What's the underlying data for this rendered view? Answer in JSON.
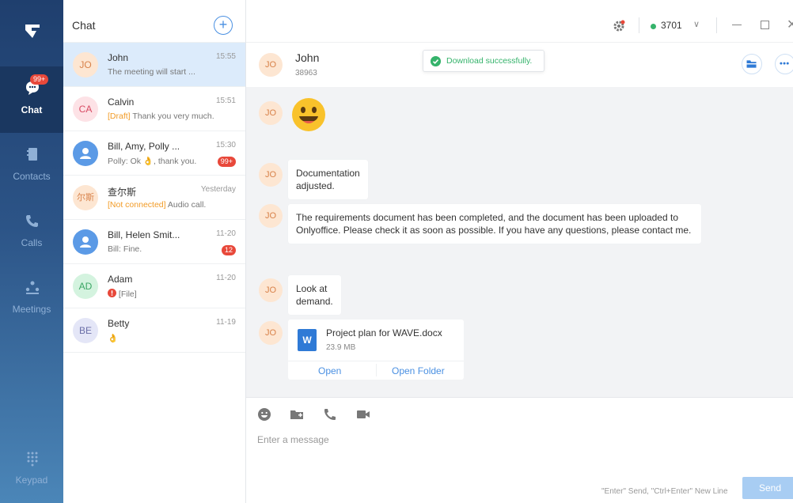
{
  "rail": {
    "chat_label": "Chat",
    "chat_badge": "99+",
    "contacts_label": "Contacts",
    "calls_label": "Calls",
    "meetings_label": "Meetings",
    "keypad_label": "Keypad"
  },
  "list": {
    "title": "Chat",
    "add": "+",
    "conversations": [
      {
        "initials": "JO",
        "name": "John",
        "time": "15:55",
        "tag": "",
        "preview": "The meeting will start ...",
        "count": ""
      },
      {
        "initials": "CA",
        "name": "Calvin",
        "time": "15:51",
        "tag": "[Draft]",
        "preview": " Thank you very much.",
        "count": ""
      },
      {
        "initials": "",
        "name": "Bill, Amy, Polly ...",
        "time": "15:30",
        "tag": "",
        "preview": "Polly: Ok 👌, thank you.",
        "count": "99+"
      },
      {
        "initials": "尔斯",
        "name": "查尔斯",
        "time": "Yesterday",
        "tag": "[Not connected]",
        "preview": " Audio call.",
        "count": ""
      },
      {
        "initials": "",
        "name": "Bill, Helen Smit...",
        "time": "11-20",
        "tag": "",
        "preview": "Bill: Fine.",
        "count": "12"
      },
      {
        "initials": "AD",
        "name": "Adam",
        "time": "11-20",
        "tag": "",
        "preview": "[File]",
        "count": ""
      },
      {
        "initials": "BE",
        "name": "Betty",
        "time": "11-19",
        "tag": "",
        "preview": "👌",
        "count": ""
      }
    ]
  },
  "topbar": {
    "extension": "3701",
    "caret": "∨",
    "close": "✕"
  },
  "chat": {
    "contact_initials": "JO",
    "contact_name": "John",
    "contact_number": "38963",
    "toast": "Download successfully.",
    "messages": [
      {
        "text": "Documentation adjusted."
      },
      {
        "text": "The requirements document has been completed, and the document has been uploaded to Onlyoffice. Please check it as soon as possible. If you have any questions, please contact me."
      },
      {
        "text": "Look at demand."
      }
    ],
    "file": {
      "icon_letter": "W",
      "name": "Project plan for WAVE.docx",
      "size": "23.9 MB",
      "open": "Open",
      "open_folder": "Open Folder"
    }
  },
  "composer": {
    "placeholder": "Enter a message",
    "hint": "\"Enter\" Send, \"Ctrl+Enter\" New Line",
    "send": "Send"
  }
}
